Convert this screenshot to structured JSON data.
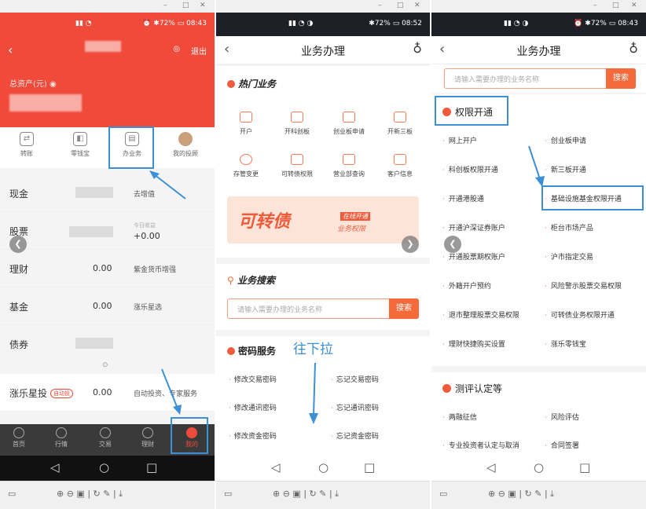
{
  "status": {
    "time1": "08:43",
    "time2": "08:52",
    "time3": "08:43",
    "battery": "72%"
  },
  "panel1": {
    "exit": "退出",
    "total_assets_label": "总资产(元)",
    "quick": [
      "转账",
      "零钱宝",
      "办业务",
      "我的投顾"
    ],
    "rows": [
      {
        "k": "现金",
        "v": "",
        "r": "去增值"
      },
      {
        "k": "股票",
        "v": "+0.00",
        "r": "今日收益"
      },
      {
        "k": "理财",
        "v": "0.00",
        "r": "紫金货币增强"
      },
      {
        "k": "基金",
        "v": "0.00",
        "r": "涨乐星选"
      },
      {
        "k": "债券",
        "v": "",
        "r": ""
      }
    ],
    "star_row": {
      "k": "涨乐星投",
      "tag": "自动投",
      "v": "0.00",
      "r": "自动投资、专家服务"
    },
    "tabs": [
      "首页",
      "行情",
      "交易",
      "理财",
      "我的"
    ]
  },
  "panel2": {
    "title": "业务办理",
    "hot_title": "热门业务",
    "hot": [
      "开户",
      "开科创板",
      "创业板申请",
      "开新三板",
      "存管变更",
      "可转债权限",
      "营业部查询",
      "客户信息"
    ],
    "banner_big": "可转债",
    "banner_tag": "在线开通",
    "banner_sub": "业务权限",
    "search_title": "业务搜索",
    "search_placeholder": "请输入需要办理的业务名称",
    "search_btn": "搜索",
    "pwd_title": "密码服务",
    "pwd_links": [
      "修改交易密码",
      "忘记交易密码",
      "修改通讯密码",
      "忘记通讯密码",
      "修改资金密码",
      "忘记资金密码"
    ],
    "annotation": "往下拉"
  },
  "panel3": {
    "title": "业务办理",
    "search_placeholder": "请输入需要办理的业务名称",
    "search_btn": "搜索",
    "perm_title": "权限开通",
    "perm_links": [
      "网上开户",
      "创业板申请",
      "科创板权限开通",
      "新三板开通",
      "开通港股通",
      "基础设施基金权限开通",
      "开通沪深证券账户",
      "柜台市场产品",
      "开通股票期权账户",
      "沪市指定交易",
      "外籍开户预约",
      "风险警示股票交易权限",
      "退市整理股票交易权限",
      "可转债业务权限开通",
      "理财快捷购买设置",
      "涨乐零钱宝"
    ],
    "test_title": "测评认定等",
    "test_links": [
      "两融征信",
      "风险评估",
      "专业投资者认定与取消",
      "合同签署"
    ]
  }
}
